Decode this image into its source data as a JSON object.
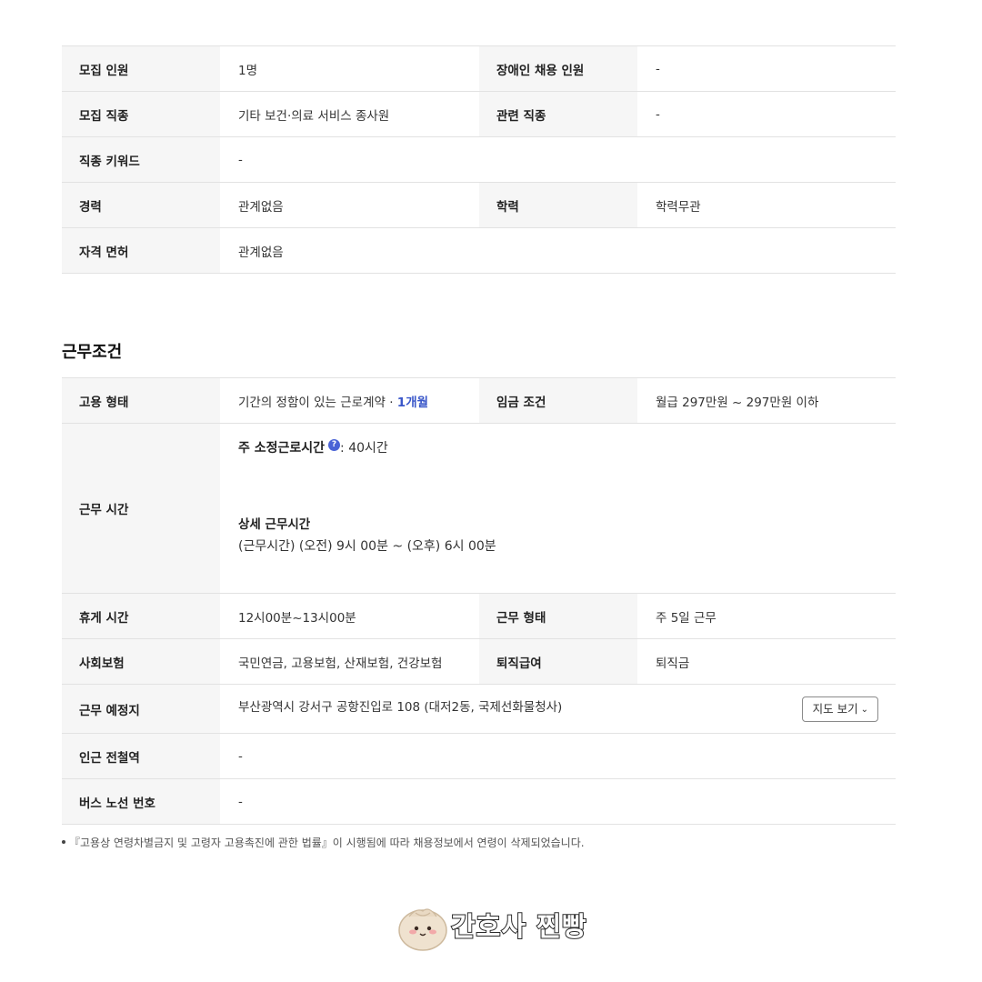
{
  "recruit_table": {
    "rows": [
      {
        "h1": "모집 인원",
        "v1": "1명",
        "h2": "장애인 채용 인원",
        "v2": "-"
      },
      {
        "h1": "모집 직종",
        "v1": "기타 보건·의료 서비스 종사원",
        "h2": "관련 직종",
        "v2": "-"
      },
      {
        "h1": "직종 키워드",
        "v1": "-"
      },
      {
        "h1": "경력",
        "v1": "관계없음",
        "h2": "학력",
        "v2": "학력무관"
      },
      {
        "h1": "자격 면허",
        "v1": "관계없음"
      }
    ]
  },
  "work_conditions": {
    "title": "근무조건",
    "employment_type_label": "고용 형태",
    "employment_type_value": "기간의 정함이 있는 근로계약 · ",
    "employment_period": "1개월",
    "wage_label": "임금 조건",
    "wage_value": "월급 297만원 ~ 297만원 이하",
    "hours_label": "근무 시간",
    "weekly_hours_label": "주 소정근로시간",
    "weekly_hours_value": ": 40시간",
    "detail_hours_label": "상세 근무시간",
    "detail_hours_value": "(근무시간) (오전) 9시 00분 ~ (오후) 6시 00분",
    "break_label": "휴게 시간",
    "break_value": "12시00분~13시00분",
    "work_form_label": "근무 형태",
    "work_form_value": "주 5일 근무",
    "insurance_label": "사회보험",
    "insurance_value": "국민연금, 고용보험, 산재보험, 건강보험",
    "severance_label": "퇴직급여",
    "severance_value": "퇴직금",
    "location_label": "근무 예정지",
    "location_value": "부산광역시 강서구 공항진입로 108 (대저2동, 국제선화물청사)",
    "map_button": "지도 보기",
    "subway_label": "인근 전철역",
    "subway_value": "-",
    "bus_label": "버스 노선 번호",
    "bus_value": "-"
  },
  "note": "『고용상 연령차별금지 및 고령자 고용촉진에 관한 법률』이 시행됨에 따라 채용정보에서 연령이 삭제되었습니다.",
  "logo_text": "간호사 찐빵",
  "icons": {
    "help": "question-circle-icon",
    "chevron": "chevron-down-icon"
  },
  "colors": {
    "accent": "#3a57c9",
    "header_bg": "#f6f6f6",
    "border": "#e2e2e2"
  }
}
